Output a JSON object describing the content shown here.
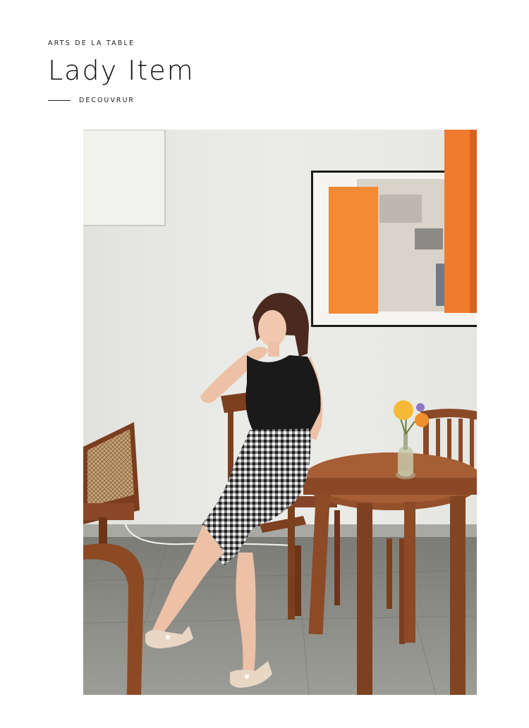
{
  "header": {
    "eyebrow": "ARTS DE LA TABLE",
    "title": "Lady Item",
    "cta_label": "DECOUVRUR"
  },
  "photo": {
    "subject": "model-seated-cafe-photo",
    "colors": {
      "wall": "#e9e9e6",
      "floor": "#8e8e88",
      "wood": "#8a4a28",
      "orange": "#f07a2e"
    }
  }
}
